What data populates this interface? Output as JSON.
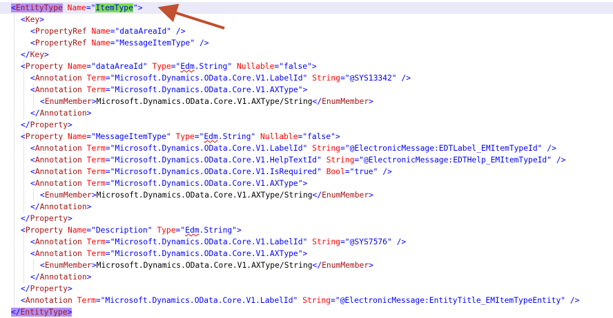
{
  "editor": {
    "lines": [
      {
        "indent": 0,
        "tokens": [
          {
            "t": "<",
            "c": "punct",
            "hl": "purple"
          },
          {
            "t": "EntityType",
            "c": "tag",
            "hl": "purple"
          },
          {
            "t": " "
          },
          {
            "t": "Name",
            "c": "attr"
          },
          {
            "t": "=\"",
            "c": "punct"
          },
          {
            "t": "ItemType",
            "c": "val",
            "hl": "green"
          },
          {
            "t": "\"",
            "c": "punct"
          },
          {
            "t": ">",
            "c": "punct"
          }
        ]
      },
      {
        "indent": 1,
        "tokens": [
          {
            "t": "<",
            "c": "punct"
          },
          {
            "t": "Key",
            "c": "tag"
          },
          {
            "t": ">",
            "c": "punct"
          }
        ]
      },
      {
        "indent": 2,
        "tokens": [
          {
            "t": "<",
            "c": "punct"
          },
          {
            "t": "PropertyRef",
            "c": "tag"
          },
          {
            "t": " "
          },
          {
            "t": "Name",
            "c": "attr"
          },
          {
            "t": "=\"",
            "c": "punct"
          },
          {
            "t": "dataAreaId",
            "c": "val"
          },
          {
            "t": "\"",
            "c": "punct"
          },
          {
            "t": " "
          },
          {
            "t": "/>",
            "c": "punct"
          }
        ]
      },
      {
        "indent": 2,
        "tokens": [
          {
            "t": "<",
            "c": "punct"
          },
          {
            "t": "PropertyRef",
            "c": "tag"
          },
          {
            "t": " "
          },
          {
            "t": "Name",
            "c": "attr"
          },
          {
            "t": "=\"",
            "c": "punct"
          },
          {
            "t": "MessageItemType",
            "c": "val"
          },
          {
            "t": "\"",
            "c": "punct"
          },
          {
            "t": " "
          },
          {
            "t": "/>",
            "c": "punct"
          }
        ]
      },
      {
        "indent": 1,
        "tokens": [
          {
            "t": "</",
            "c": "punct"
          },
          {
            "t": "Key",
            "c": "tag"
          },
          {
            "t": ">",
            "c": "punct"
          }
        ]
      },
      {
        "indent": 1,
        "tokens": [
          {
            "t": "<",
            "c": "punct"
          },
          {
            "t": "Property",
            "c": "tag"
          },
          {
            "t": " "
          },
          {
            "t": "Name",
            "c": "attr"
          },
          {
            "t": "=\"",
            "c": "punct"
          },
          {
            "t": "dataAreaId",
            "c": "val"
          },
          {
            "t": "\"",
            "c": "punct"
          },
          {
            "t": " "
          },
          {
            "t": "Type",
            "c": "attr"
          },
          {
            "t": "=\"",
            "c": "punct"
          },
          {
            "t": "Edm",
            "c": "val",
            "sq": true
          },
          {
            "t": ".String",
            "c": "val"
          },
          {
            "t": "\"",
            "c": "punct"
          },
          {
            "t": " "
          },
          {
            "t": "Nullable",
            "c": "attr"
          },
          {
            "t": "=\"",
            "c": "punct"
          },
          {
            "t": "false",
            "c": "val"
          },
          {
            "t": "\"",
            "c": "punct"
          },
          {
            "t": ">",
            "c": "punct"
          }
        ]
      },
      {
        "indent": 2,
        "tokens": [
          {
            "t": "<",
            "c": "punct"
          },
          {
            "t": "Annotation",
            "c": "tag"
          },
          {
            "t": " "
          },
          {
            "t": "Term",
            "c": "attr"
          },
          {
            "t": "=\"",
            "c": "punct"
          },
          {
            "t": "Microsoft.Dynamics.OData.Core.V1.LabelId",
            "c": "val"
          },
          {
            "t": "\"",
            "c": "punct"
          },
          {
            "t": " "
          },
          {
            "t": "String",
            "c": "attr"
          },
          {
            "t": "=\"",
            "c": "punct"
          },
          {
            "t": "@SYS13342",
            "c": "val"
          },
          {
            "t": "\"",
            "c": "punct"
          },
          {
            "t": " "
          },
          {
            "t": "/>",
            "c": "punct"
          }
        ]
      },
      {
        "indent": 2,
        "tokens": [
          {
            "t": "<",
            "c": "punct"
          },
          {
            "t": "Annotation",
            "c": "tag"
          },
          {
            "t": " "
          },
          {
            "t": "Term",
            "c": "attr"
          },
          {
            "t": "=\"",
            "c": "punct"
          },
          {
            "t": "Microsoft.Dynamics.OData.Core.V1.AXType",
            "c": "val"
          },
          {
            "t": "\"",
            "c": "punct"
          },
          {
            "t": ">",
            "c": "punct"
          }
        ]
      },
      {
        "indent": 3,
        "tokens": [
          {
            "t": "<",
            "c": "punct"
          },
          {
            "t": "EnumMember",
            "c": "tag"
          },
          {
            "t": ">",
            "c": "punct"
          },
          {
            "t": "Microsoft.Dynamics.OData.Core.V1.AXType/String",
            "c": "text"
          },
          {
            "t": "</",
            "c": "punct"
          },
          {
            "t": "EnumMember",
            "c": "tag"
          },
          {
            "t": ">",
            "c": "punct"
          }
        ]
      },
      {
        "indent": 2,
        "tokens": [
          {
            "t": "</",
            "c": "punct"
          },
          {
            "t": "Annotation",
            "c": "tag"
          },
          {
            "t": ">",
            "c": "punct"
          }
        ]
      },
      {
        "indent": 1,
        "tokens": [
          {
            "t": "</",
            "c": "punct"
          },
          {
            "t": "Property",
            "c": "tag"
          },
          {
            "t": ">",
            "c": "punct"
          }
        ]
      },
      {
        "indent": 1,
        "tokens": [
          {
            "t": "<",
            "c": "punct"
          },
          {
            "t": "Property",
            "c": "tag"
          },
          {
            "t": " "
          },
          {
            "t": "Name",
            "c": "attr"
          },
          {
            "t": "=\"",
            "c": "punct"
          },
          {
            "t": "MessageItemType",
            "c": "val"
          },
          {
            "t": "\"",
            "c": "punct"
          },
          {
            "t": " "
          },
          {
            "t": "Type",
            "c": "attr"
          },
          {
            "t": "=\"",
            "c": "punct"
          },
          {
            "t": "Edm",
            "c": "val",
            "sq": true
          },
          {
            "t": ".String",
            "c": "val"
          },
          {
            "t": "\"",
            "c": "punct"
          },
          {
            "t": " "
          },
          {
            "t": "Nullable",
            "c": "attr"
          },
          {
            "t": "=\"",
            "c": "punct"
          },
          {
            "t": "false",
            "c": "val"
          },
          {
            "t": "\"",
            "c": "punct"
          },
          {
            "t": ">",
            "c": "punct"
          }
        ]
      },
      {
        "indent": 2,
        "tokens": [
          {
            "t": "<",
            "c": "punct"
          },
          {
            "t": "Annotation",
            "c": "tag"
          },
          {
            "t": " "
          },
          {
            "t": "Term",
            "c": "attr"
          },
          {
            "t": "=\"",
            "c": "punct"
          },
          {
            "t": "Microsoft.Dynamics.OData.Core.V1.LabelId",
            "c": "val"
          },
          {
            "t": "\"",
            "c": "punct"
          },
          {
            "t": " "
          },
          {
            "t": "String",
            "c": "attr"
          },
          {
            "t": "=\"",
            "c": "punct"
          },
          {
            "t": "@ElectronicMessage:EDTLabel_EMItemTypeId",
            "c": "val"
          },
          {
            "t": "\"",
            "c": "punct"
          },
          {
            "t": " "
          },
          {
            "t": "/>",
            "c": "punct"
          }
        ]
      },
      {
        "indent": 2,
        "tokens": [
          {
            "t": "<",
            "c": "punct"
          },
          {
            "t": "Annotation",
            "c": "tag"
          },
          {
            "t": " "
          },
          {
            "t": "Term",
            "c": "attr"
          },
          {
            "t": "=\"",
            "c": "punct"
          },
          {
            "t": "Microsoft.Dynamics.OData.Core.V1.HelpTextId",
            "c": "val"
          },
          {
            "t": "\"",
            "c": "punct"
          },
          {
            "t": " "
          },
          {
            "t": "String",
            "c": "attr"
          },
          {
            "t": "=\"",
            "c": "punct"
          },
          {
            "t": "@ElectronicMessage:EDTHelp_EMItemTypeId",
            "c": "val"
          },
          {
            "t": "\"",
            "c": "punct"
          },
          {
            "t": " "
          },
          {
            "t": "/>",
            "c": "punct"
          }
        ]
      },
      {
        "indent": 2,
        "tokens": [
          {
            "t": "<",
            "c": "punct"
          },
          {
            "t": "Annotation",
            "c": "tag"
          },
          {
            "t": " "
          },
          {
            "t": "Term",
            "c": "attr"
          },
          {
            "t": "=\"",
            "c": "punct"
          },
          {
            "t": "Microsoft.Dynamics.OData.Core.V1.IsRequired",
            "c": "val"
          },
          {
            "t": "\"",
            "c": "punct"
          },
          {
            "t": " "
          },
          {
            "t": "Bool",
            "c": "attr"
          },
          {
            "t": "=\"",
            "c": "punct"
          },
          {
            "t": "true",
            "c": "val"
          },
          {
            "t": "\"",
            "c": "punct"
          },
          {
            "t": " "
          },
          {
            "t": "/>",
            "c": "punct"
          }
        ]
      },
      {
        "indent": 2,
        "tokens": [
          {
            "t": "<",
            "c": "punct"
          },
          {
            "t": "Annotation",
            "c": "tag"
          },
          {
            "t": " "
          },
          {
            "t": "Term",
            "c": "attr"
          },
          {
            "t": "=\"",
            "c": "punct"
          },
          {
            "t": "Microsoft.Dynamics.OData.Core.V1.AXType",
            "c": "val"
          },
          {
            "t": "\"",
            "c": "punct"
          },
          {
            "t": ">",
            "c": "punct"
          }
        ]
      },
      {
        "indent": 3,
        "tokens": [
          {
            "t": "<",
            "c": "punct"
          },
          {
            "t": "EnumMember",
            "c": "tag"
          },
          {
            "t": ">",
            "c": "punct"
          },
          {
            "t": "Microsoft.Dynamics.OData.Core.V1.AXType/String",
            "c": "text"
          },
          {
            "t": "</",
            "c": "punct"
          },
          {
            "t": "EnumMember",
            "c": "tag"
          },
          {
            "t": ">",
            "c": "punct"
          }
        ]
      },
      {
        "indent": 2,
        "tokens": [
          {
            "t": "</",
            "c": "punct"
          },
          {
            "t": "Annotation",
            "c": "tag"
          },
          {
            "t": ">",
            "c": "punct"
          }
        ]
      },
      {
        "indent": 1,
        "tokens": [
          {
            "t": "</",
            "c": "punct"
          },
          {
            "t": "Property",
            "c": "tag"
          },
          {
            "t": ">",
            "c": "punct"
          }
        ]
      },
      {
        "indent": 1,
        "tokens": [
          {
            "t": "<",
            "c": "punct"
          },
          {
            "t": "Property",
            "c": "tag"
          },
          {
            "t": " "
          },
          {
            "t": "Name",
            "c": "attr"
          },
          {
            "t": "=\"",
            "c": "punct"
          },
          {
            "t": "Description",
            "c": "val"
          },
          {
            "t": "\"",
            "c": "punct"
          },
          {
            "t": " "
          },
          {
            "t": "Type",
            "c": "attr"
          },
          {
            "t": "=\"",
            "c": "punct"
          },
          {
            "t": "Edm",
            "c": "val",
            "sq": true
          },
          {
            "t": ".String",
            "c": "val"
          },
          {
            "t": "\"",
            "c": "punct"
          },
          {
            "t": ">",
            "c": "punct"
          }
        ]
      },
      {
        "indent": 2,
        "tokens": [
          {
            "t": "<",
            "c": "punct"
          },
          {
            "t": "Annotation",
            "c": "tag"
          },
          {
            "t": " "
          },
          {
            "t": "Term",
            "c": "attr"
          },
          {
            "t": "=\"",
            "c": "punct"
          },
          {
            "t": "Microsoft.Dynamics.OData.Core.V1.LabelId",
            "c": "val"
          },
          {
            "t": "\"",
            "c": "punct"
          },
          {
            "t": " "
          },
          {
            "t": "String",
            "c": "attr"
          },
          {
            "t": "=\"",
            "c": "punct"
          },
          {
            "t": "@SYS7576",
            "c": "val"
          },
          {
            "t": "\"",
            "c": "punct"
          },
          {
            "t": " "
          },
          {
            "t": "/>",
            "c": "punct"
          }
        ]
      },
      {
        "indent": 2,
        "tokens": [
          {
            "t": "<",
            "c": "punct"
          },
          {
            "t": "Annotation",
            "c": "tag"
          },
          {
            "t": " "
          },
          {
            "t": "Term",
            "c": "attr"
          },
          {
            "t": "=\"",
            "c": "punct"
          },
          {
            "t": "Microsoft.Dynamics.OData.Core.V1.AXType",
            "c": "val"
          },
          {
            "t": "\"",
            "c": "punct"
          },
          {
            "t": ">",
            "c": "punct"
          }
        ]
      },
      {
        "indent": 3,
        "tokens": [
          {
            "t": "<",
            "c": "punct"
          },
          {
            "t": "EnumMember",
            "c": "tag"
          },
          {
            "t": ">",
            "c": "punct"
          },
          {
            "t": "Microsoft.Dynamics.OData.Core.V1.AXType/String",
            "c": "text"
          },
          {
            "t": "</",
            "c": "punct"
          },
          {
            "t": "EnumMember",
            "c": "tag"
          },
          {
            "t": ">",
            "c": "punct"
          }
        ]
      },
      {
        "indent": 2,
        "tokens": [
          {
            "t": "</",
            "c": "punct"
          },
          {
            "t": "Annotation",
            "c": "tag"
          },
          {
            "t": ">",
            "c": "punct"
          }
        ]
      },
      {
        "indent": 1,
        "tokens": [
          {
            "t": "</",
            "c": "punct"
          },
          {
            "t": "Property",
            "c": "tag"
          },
          {
            "t": ">",
            "c": "punct"
          }
        ]
      },
      {
        "indent": 1,
        "tokens": [
          {
            "t": "<",
            "c": "punct"
          },
          {
            "t": "Annotation",
            "c": "tag"
          },
          {
            "t": " "
          },
          {
            "t": "Term",
            "c": "attr"
          },
          {
            "t": "=\"",
            "c": "punct"
          },
          {
            "t": "Microsoft.Dynamics.OData.Core.V1.LabelId",
            "c": "val"
          },
          {
            "t": "\"",
            "c": "punct"
          },
          {
            "t": " "
          },
          {
            "t": "String",
            "c": "attr"
          },
          {
            "t": "=\"",
            "c": "punct"
          },
          {
            "t": "@ElectronicMessage:EntityTitle_EMItemTypeEntity",
            "c": "val"
          },
          {
            "t": "\"",
            "c": "punct"
          },
          {
            "t": " "
          },
          {
            "t": "/>",
            "c": "punct"
          }
        ]
      },
      {
        "indent": 0,
        "tokens": [
          {
            "t": "</",
            "c": "punct",
            "hl": "purple"
          },
          {
            "t": "EntityType",
            "c": "tag",
            "hl": "purple"
          },
          {
            "t": ">",
            "c": "punct",
            "hl": "purple"
          }
        ]
      }
    ],
    "colors": {
      "punct": "#0000ff",
      "tag": "#a31515",
      "attr": "#ff0000",
      "val": "#0000ff",
      "text": "#000000",
      "line_highlight": "#eae9f7",
      "match_highlight_purple": "#b48ef2",
      "match_highlight_green": "#7ee04a",
      "annotation_arrow": "#c0502e"
    }
  },
  "annotation": {
    "icon": "arrow-icon",
    "points_to": "ItemType"
  }
}
